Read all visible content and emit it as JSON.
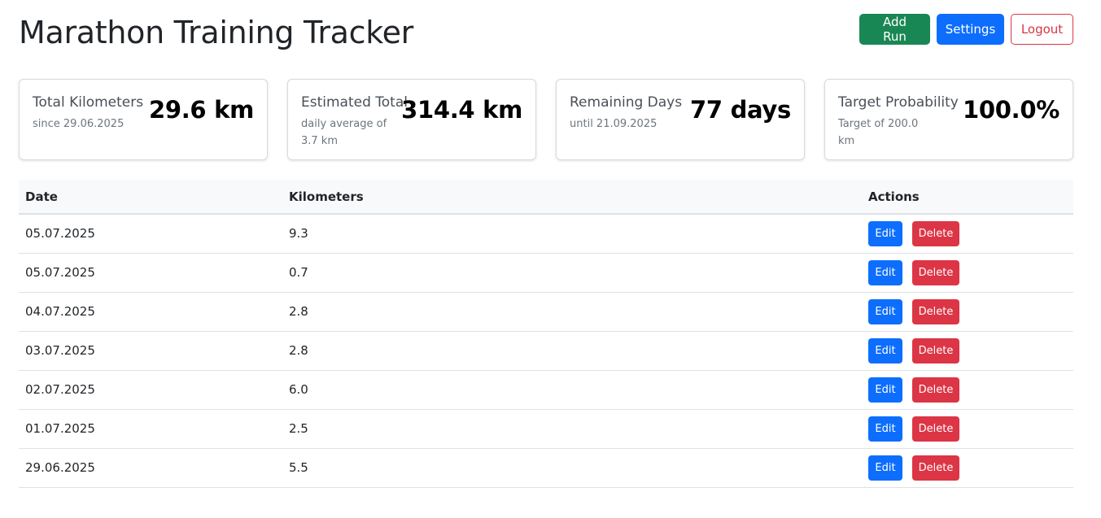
{
  "header": {
    "title": "Marathon Training Tracker",
    "add_run_label": "Add Run",
    "settings_label": "Settings",
    "logout_label": "Logout"
  },
  "cards": [
    {
      "label": "Total Kilometers",
      "sub": "since 29.06.2025",
      "value": "29.6 km"
    },
    {
      "label": "Estimated Total",
      "sub": "daily average of 3.7 km",
      "value": "314.4 km"
    },
    {
      "label": "Remaining Days",
      "sub": "until 21.09.2025",
      "value": "77 days"
    },
    {
      "label": "Target Probability",
      "sub": "Target of 200.0 km",
      "value": "100.0%"
    }
  ],
  "table": {
    "headers": {
      "date": "Date",
      "km": "Kilometers",
      "actions": "Actions"
    },
    "edit_label": "Edit",
    "delete_label": "Delete",
    "rows": [
      {
        "date": "05.07.2025",
        "km": "9.3"
      },
      {
        "date": "05.07.2025",
        "km": "0.7"
      },
      {
        "date": "04.07.2025",
        "km": "2.8"
      },
      {
        "date": "03.07.2025",
        "km": "2.8"
      },
      {
        "date": "02.07.2025",
        "km": "6.0"
      },
      {
        "date": "01.07.2025",
        "km": "2.5"
      },
      {
        "date": "29.06.2025",
        "km": "5.5"
      }
    ]
  },
  "colors": {
    "success": "#198754",
    "primary": "#0d6efd",
    "danger": "#dc3545"
  }
}
